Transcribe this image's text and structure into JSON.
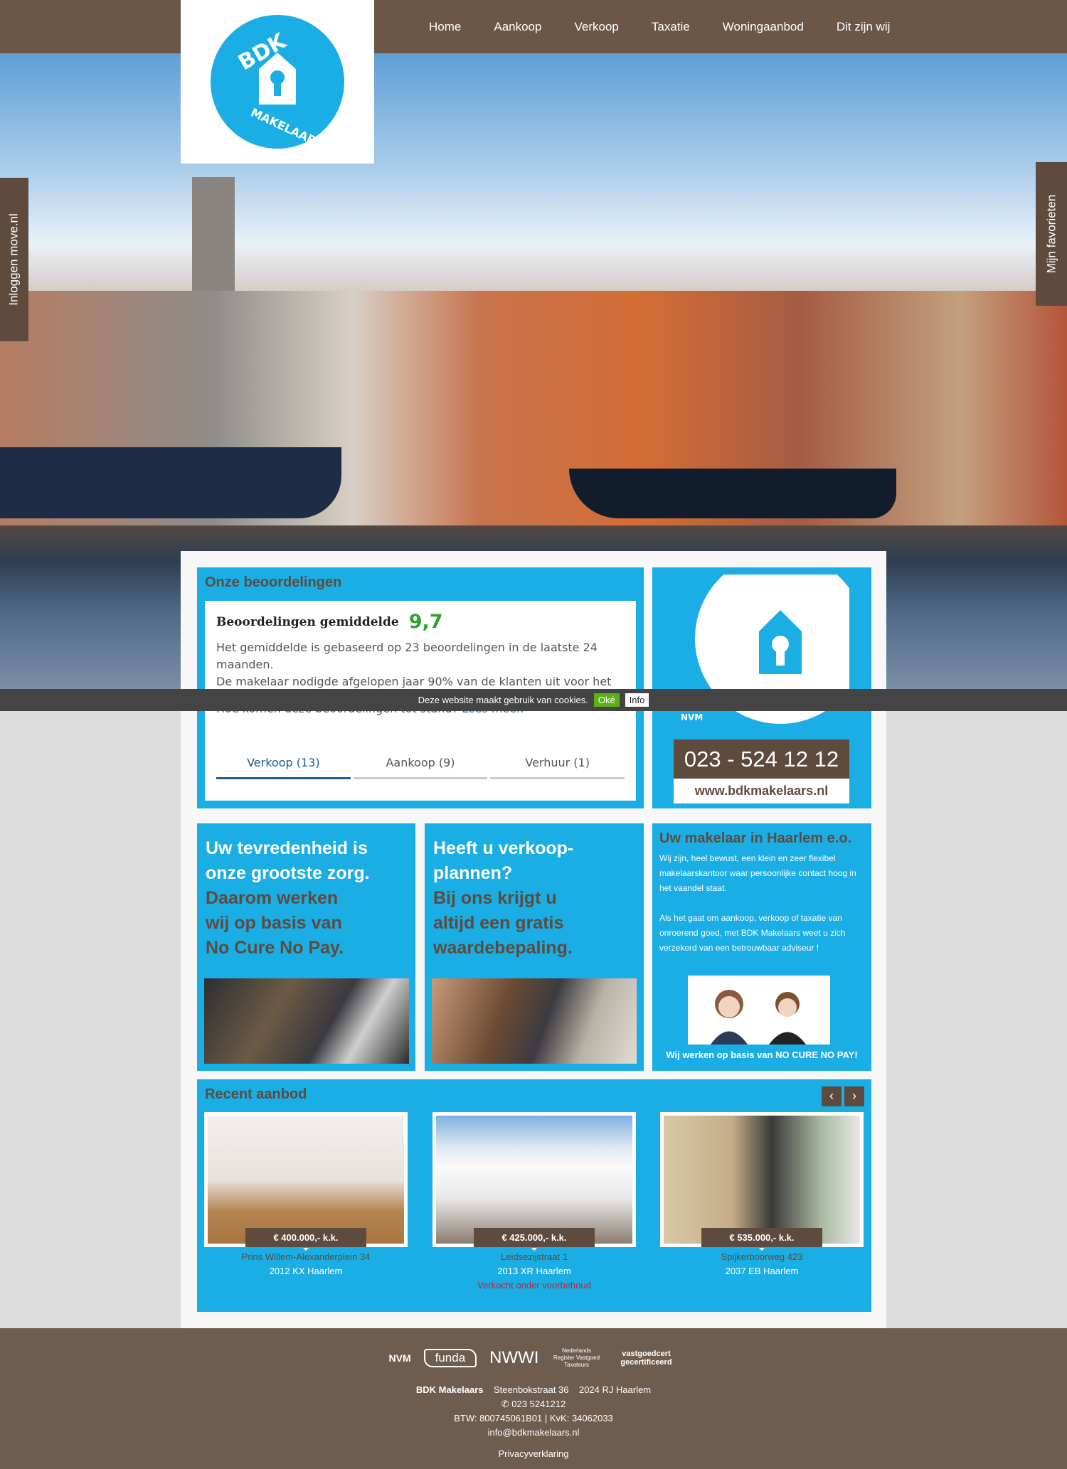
{
  "nav": [
    "Home",
    "Aankoop",
    "Verkoop",
    "Taxatie",
    "Woningaanbod",
    "Dit zijn wij"
  ],
  "logo": {
    "text": "BDK MAKELAARS",
    "color": "#1aaee4"
  },
  "side_tabs": {
    "left": "Inloggen move.nl",
    "right": "Mijn favorieten"
  },
  "reviews": {
    "title": "Onze beoordelingen",
    "avg_label": "Beoordelingen gemiddelde",
    "score": "9,7",
    "text1": "Het gemiddelde is gebaseerd op 23 beoordelingen in de laatste 24 maanden.",
    "text2": "De makelaar nodigde afgelopen jaar 90% van de klanten uit voor het",
    "how": "Hoe komen deze beoordelingen tot stand?",
    "more": "Lees meer.",
    "tabs": [
      "Verkoop (13)",
      "Aankoop (9)",
      "Verhuur (1)"
    ]
  },
  "brand_box": {
    "nvm": "NVM",
    "phone": "023 - 524 12 12",
    "url": "www.bdkmakelaars.nl"
  },
  "cookie": {
    "text": "Deze website maakt gebruik van cookies.",
    "ok": "Oké",
    "info": "Info"
  },
  "promo1": {
    "white": [
      "Uw tevredenheid is",
      "onze grootste zorg."
    ],
    "brown": [
      "Daarom werken",
      "wij op basis van",
      "No Cure No Pay."
    ]
  },
  "promo2": {
    "white": [
      "Heeft u verkoop-",
      "plannen?"
    ],
    "brown": [
      "Bij ons krijgt u",
      "altijd een gratis",
      "waardebepaling."
    ]
  },
  "about": {
    "title": "Uw makelaar in Haarlem e.o.",
    "p1": "Wij zijn, heel bewust, een klein en zeer flexibel makelaarskantoor waar persoonlijke contact hoog in het vaandel staat.",
    "p2": "Als het gaat om aankoop, verkoop of taxatie van onroerend goed, met BDK Makelaars weet u zich verzekerd van een betrouwbaar adviseur !",
    "footer": "Wij werken op basis van NO CURE NO PAY!"
  },
  "recent": {
    "title": "Recent aanbod",
    "items": [
      {
        "price": "€ 400.000,- k.k.",
        "street": "Prins Willem-Alexanderplein 34",
        "city": "2012 KX Haarlem",
        "status": ""
      },
      {
        "price": "€ 425.000,- k.k.",
        "street": "Leidsezijstraat 1",
        "city": "2013 XR Haarlem",
        "status": "Verkocht onder voorbehoud"
      },
      {
        "price": "€ 535.000,- k.k.",
        "street": "Spijkerboorweg 423",
        "city": "2037 EB Haarlem",
        "status": ""
      }
    ]
  },
  "footer": {
    "logos": [
      "NVM",
      "funda",
      "NWWI",
      "Nederlands Register Vastgoed Taxateurs",
      "vastgoedcert gecertificeerd"
    ],
    "company": "BDK Makelaars",
    "street": "Steenbokstraat 36",
    "city": "2024 RJ Haarlem",
    "phone": "023 5241212",
    "tax": "BTW: 800745061B01 | KvK: 34062033",
    "email": "info@bdkmakelaars.nl",
    "privacy": "Privacyverklaring"
  },
  "colors": {
    "blue": "#1aaee4",
    "brown": "#5f4b3e",
    "green": "#2ea12e"
  }
}
